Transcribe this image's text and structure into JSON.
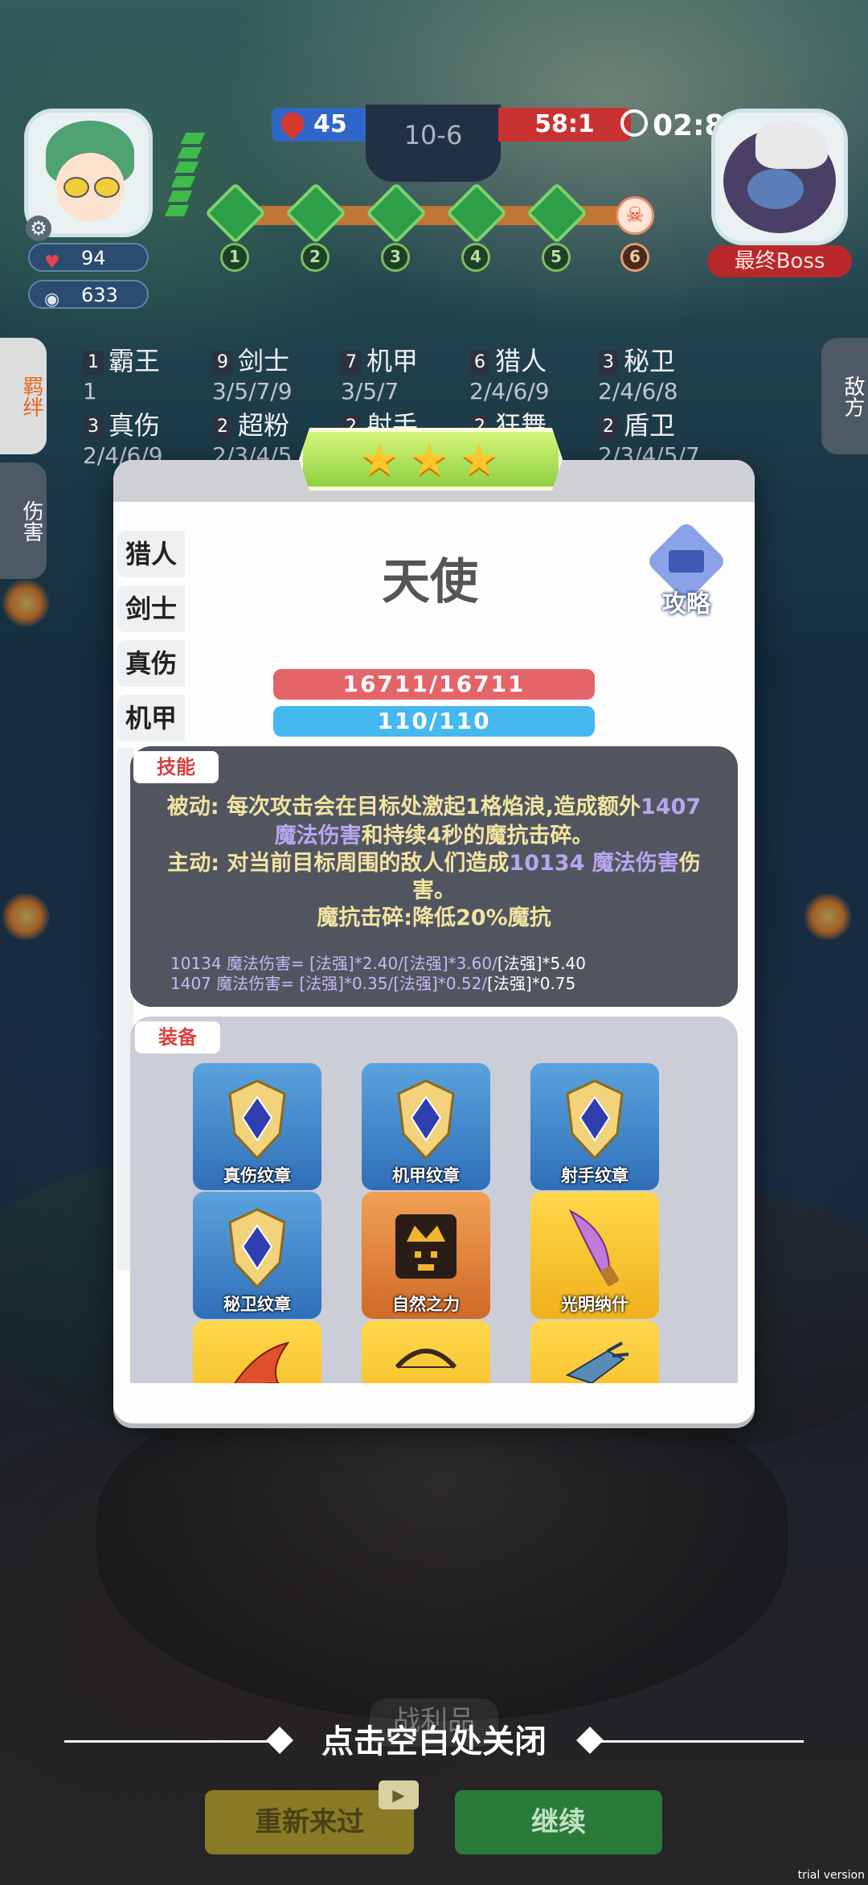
{
  "hud": {
    "player_hp": "94",
    "player_gold": "633",
    "score_left": "45",
    "round": "10-6",
    "score_right": "58:1",
    "timer": "02:8",
    "stages": [
      "1",
      "2",
      "3",
      "4",
      "5",
      "6"
    ],
    "boss_label": "最终Boss"
  },
  "side_tabs": {
    "synergy": "羁绊",
    "damage": "伤害",
    "enemy": "敌方"
  },
  "synergies": [
    {
      "count": "1",
      "name": "霸王",
      "tiers": "1"
    },
    {
      "count": "9",
      "name": "剑士",
      "tiers": "3/5/7/9"
    },
    {
      "count": "7",
      "name": "机甲",
      "tiers": "3/5/7"
    },
    {
      "count": "6",
      "name": "猎人",
      "tiers": "2/4/6/9"
    },
    {
      "count": "3",
      "name": "秘卫",
      "tiers": "2/4/6/8"
    },
    {
      "count": "3",
      "name": "真伤",
      "tiers": "2/4/6/9"
    },
    {
      "count": "2",
      "name": "超粉",
      "tiers": "2/3/4/5"
    },
    {
      "count": "2",
      "name": "射手",
      "tiers": ""
    },
    {
      "count": "2",
      "name": "狂舞",
      "tiers": ""
    },
    {
      "count": "2",
      "name": "盾卫",
      "tiers": "2/3/4/5/7"
    }
  ],
  "modal": {
    "stars": 3,
    "unit_name": "天使",
    "guide_label": "攻略",
    "hp": "16711/16711",
    "mp": "110/110",
    "class_tabs": [
      "猎人",
      "剑士",
      "真伤",
      "机甲"
    ],
    "skill": {
      "tag": "技能",
      "passive_a": "被动: 每次攻击会在目标处激起1格焰浪,造成额外",
      "passive_hl1": "1407",
      "passive_hl2": "魔法伤害",
      "passive_b": "和持续4秒的魔抗击碎。",
      "active_a": "主动: 对当前目标周围的敌人们造成",
      "active_hl": "10134 魔法伤害",
      "active_b": "伤",
      "active_c": "害。",
      "debuff": "魔抗击碎:降低20%魔抗",
      "formula1_a": "10134 魔法伤害= [法强]*2.40/[法强]*3.60/",
      "formula1_b": "[法强]*5.40",
      "formula2_a": "1407 魔法伤害= [法强]*0.35/[法强]*0.52/",
      "formula2_b": "[法强]*0.75"
    },
    "equipment": {
      "tag": "装备",
      "items": [
        {
          "label": "真伤纹章",
          "color": "blue",
          "icon": "emblem-icon"
        },
        {
          "label": "机甲纹章",
          "color": "blue",
          "icon": "emblem-icon"
        },
        {
          "label": "射手纹章",
          "color": "blue",
          "icon": "emblem-icon"
        },
        {
          "label": "秘卫纹章",
          "color": "blue",
          "icon": "emblem-icon"
        },
        {
          "label": "自然之力",
          "color": "orange",
          "icon": "crown-face-icon"
        },
        {
          "label": "光明纳什",
          "color": "yellow",
          "icon": "dagger-icon"
        },
        {
          "label": "",
          "color": "yellow",
          "icon": "flame-blade-icon"
        },
        {
          "label": "",
          "color": "yellow",
          "icon": "bow-icon"
        },
        {
          "label": "",
          "color": "yellow",
          "icon": "trident-icon"
        }
      ]
    }
  },
  "bottom": {
    "close_hint": "点击空白处关闭",
    "spoils": "战利品",
    "retry": "重新来过",
    "continue": "继续",
    "trial": "trial version"
  }
}
